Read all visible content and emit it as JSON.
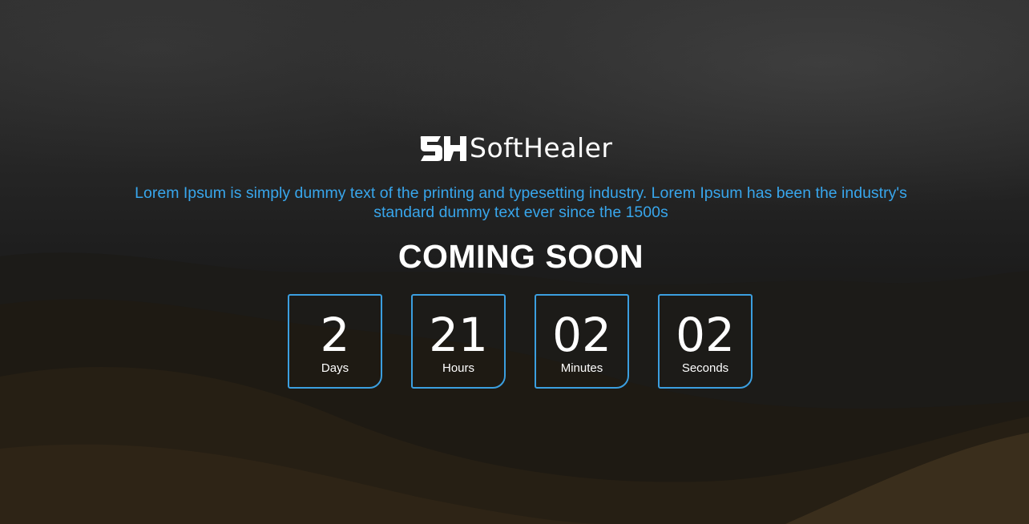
{
  "brand": {
    "logo_text": "SoftHealer"
  },
  "tagline": "Lorem Ipsum is simply dummy text of the printing and typesetting industry. Lorem Ipsum has been the industry's standard dummy text ever since the 1500s",
  "heading": "COMING SOON",
  "countdown": [
    {
      "value": "2",
      "label": "Days"
    },
    {
      "value": "21",
      "label": "Hours"
    },
    {
      "value": "02",
      "label": "Minutes"
    },
    {
      "value": "02",
      "label": "Seconds"
    }
  ],
  "colors": {
    "accent": "#38a6ec",
    "counter_border": "#3b9fe0",
    "text": "#ffffff"
  }
}
